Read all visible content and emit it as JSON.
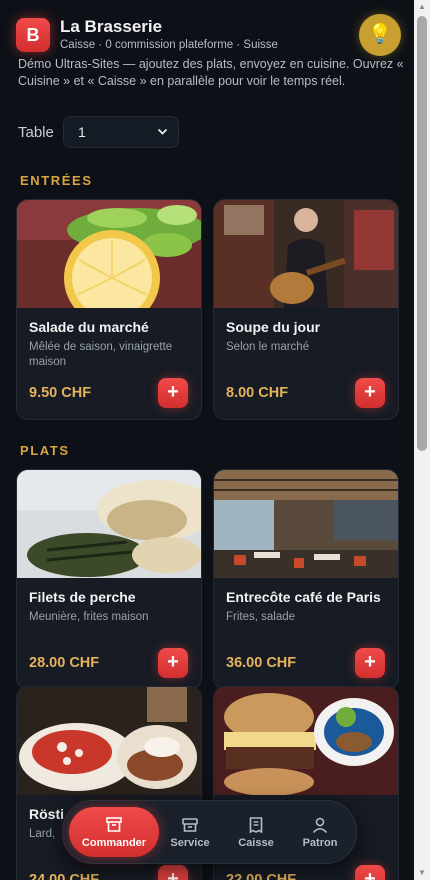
{
  "header": {
    "logo_letter": "B",
    "title": "La Brasserie",
    "subtitle": "Caisse · 0 commission plateforme · Suisse",
    "theme_icon": "lightbulb-icon"
  },
  "demo_text": "Démo Ultras-Sites — ajoutez des plats, envoyez en cuisine. Ouvrez « Cuisine » et « Caisse » en parallèle pour voir le temps réel.",
  "table": {
    "label": "Table",
    "value": "1"
  },
  "sections": [
    {
      "title": "ENTRÉES",
      "items": [
        {
          "name": "Salade du marché",
          "description": "Mêlée de saison, vinaigrette maison",
          "price": "9.50 CHF",
          "photo": "salad-photo"
        },
        {
          "name": "Soupe du jour",
          "description": "Selon le marché",
          "price": "8.00 CHF",
          "photo": "guitarist-photo"
        }
      ]
    },
    {
      "title": "PLATS",
      "items": [
        {
          "name": "Filets de perche",
          "description": "Meunière, frites maison",
          "price": "28.00 CHF",
          "photo": "fish-plate-photo"
        },
        {
          "name": "Entrecôte café de Paris",
          "description": "Frites, salade",
          "price": "36.00 CHF",
          "photo": "restaurant-interior-photo"
        },
        {
          "name": "Rösti",
          "description": "Lard,",
          "price": "24.00 CHF",
          "photo": "breakfast-plate-photo"
        },
        {
          "name": "",
          "description": "",
          "price": "22.00 CHF",
          "photo": "burger-photo"
        }
      ]
    }
  ],
  "add_label": "+",
  "nav": [
    {
      "label": "Commander",
      "icon": "inbox-icon",
      "active": true
    },
    {
      "label": "Service",
      "icon": "tray-icon",
      "active": false
    },
    {
      "label": "Caisse",
      "icon": "receipt-icon",
      "active": false
    },
    {
      "label": "Patron",
      "icon": "user-icon",
      "active": false
    }
  ],
  "colors": {
    "accent": "#e53935",
    "gold": "#d9a441",
    "price": "#e6b25c",
    "background": "#0d1117",
    "card": "#161b24"
  }
}
